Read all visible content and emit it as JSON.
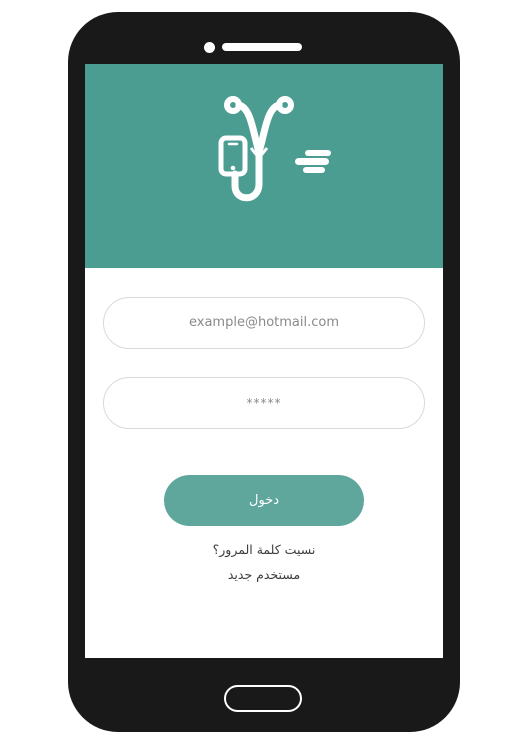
{
  "login": {
    "email_placeholder": "example@hotmail.com",
    "password_placeholder": "*****",
    "submit_label": "دخول",
    "forgot_password": "نسيت كلمة المرور؟",
    "new_user": "مستخدم جديد"
  },
  "icons": {
    "logo": "stethoscope-phone-icon",
    "home": "home-button-icon"
  },
  "colors": {
    "header": "#4c9d91",
    "accent": "#5fa79c",
    "device": "#191919"
  }
}
